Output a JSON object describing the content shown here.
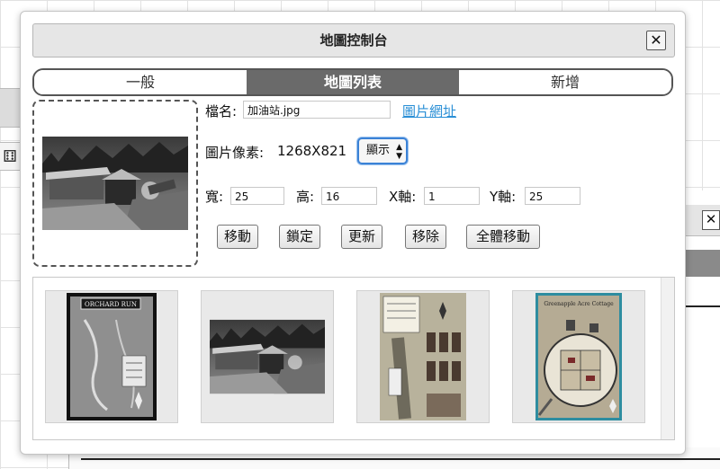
{
  "dialog": {
    "title": "地圖控制台",
    "close_label": "✕"
  },
  "tabs": [
    {
      "label": "一般",
      "active": false
    },
    {
      "label": "地圖列表",
      "active": true
    },
    {
      "label": "新增",
      "active": false
    }
  ],
  "form": {
    "filename_label": "檔名:",
    "filename_value": "加油站.jpg",
    "image_url_link": "圖片網址",
    "pixels_label": "圖片像素:",
    "pixels_value": "1268X821",
    "display_select": "顯示",
    "width_label": "寬:",
    "width_value": "25",
    "height_label": "高:",
    "height_value": "16",
    "x_label": "X軸:",
    "x_value": "1",
    "y_label": "Y軸:",
    "y_value": "25"
  },
  "buttons": {
    "move": "移動",
    "lock": "鎖定",
    "update": "更新",
    "remove": "移除",
    "move_all": "全體移動"
  },
  "thumbnails": [
    {
      "name": "orchard-run-map",
      "caption": "ORCHARD RUN"
    },
    {
      "name": "gas-station-map",
      "caption": ""
    },
    {
      "name": "street-town-map",
      "caption": ""
    },
    {
      "name": "cottage-map",
      "caption": "Greenapple Acre Cottage"
    }
  ],
  "colors": {
    "active_tab": "#6a6a6a",
    "link": "#2a8fd6",
    "select_focus": "#3b82d6"
  }
}
